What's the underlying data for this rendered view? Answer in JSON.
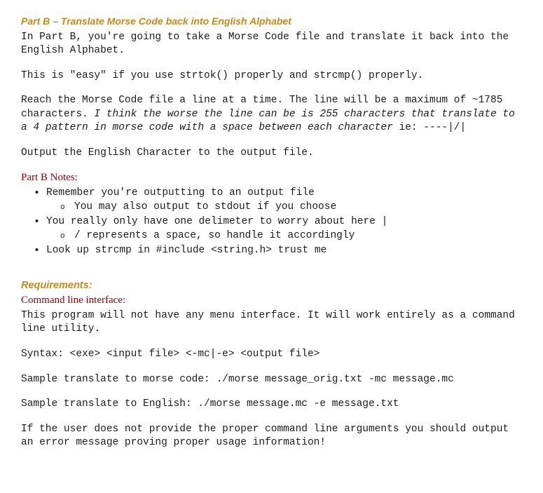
{
  "partB": {
    "heading": "Part B – Translate Morse Code back into English Alphabet",
    "intro": "In Part B, you're going to take a Morse Code file and translate it back into the English Alphabet.",
    "easy": "This is \"easy\" if you use strtok() properly and strcmp() properly.",
    "reach_pre": "Reach the Morse Code file a line at a time.  The line will be a maximum of ~1785 characters.  ",
    "reach_italic": "I think the worse the line can be is 255 characters that translate to a 4 pattern in morse code with a space between each character",
    "reach_post": " ie: ----|/|",
    "output": "Output the English Character to the output file.",
    "notes_heading": "Part B Notes:",
    "notes": {
      "b1": "Remember you're outputting to an output file",
      "b1_sub": "You may also output to stdout if you choose",
      "b2": "You really only have one delimeter to worry about here |",
      "b2_sub": "/ represents a space, so handle it accordingly",
      "b3": "Look up strcmp in #include <string.h> trust me"
    }
  },
  "requirements": {
    "heading": "Requirements:",
    "cli_heading": "Command line interface:",
    "cli_intro": "This program will not have any menu interface.  It will work entirely as a command line utility.",
    "syntax": "Syntax: <exe> <input file> <-mc|-e> <output file>",
    "sample_mc": "Sample translate to morse code: ./morse message_orig.txt -mc message.mc",
    "sample_e": "Sample translate to English: ./morse message.mc -e message.txt",
    "error": "If the user does not provide the proper command line arguments you should output an error message proving proper usage information!"
  }
}
